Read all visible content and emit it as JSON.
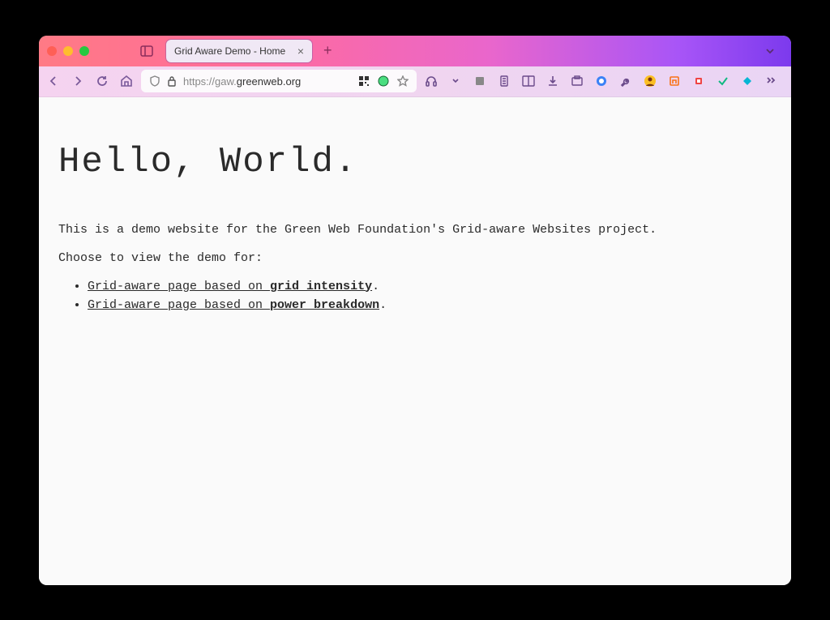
{
  "tab": {
    "title": "Grid Aware Demo - Home"
  },
  "url": {
    "scheme_host_prefix": "https://gaw.",
    "domain": "greenweb.org"
  },
  "page": {
    "heading": "Hello, World.",
    "intro": "This is a demo website for the Green Web Foundation's Grid-aware Websites project.",
    "prompt": "Choose to view the demo for:",
    "links": [
      {
        "prefix": "Grid-aware page based on ",
        "emph": "grid intensity",
        "suffix": "."
      },
      {
        "prefix": "Grid-aware page based on ",
        "emph": "power breakdown",
        "suffix": "."
      }
    ]
  }
}
